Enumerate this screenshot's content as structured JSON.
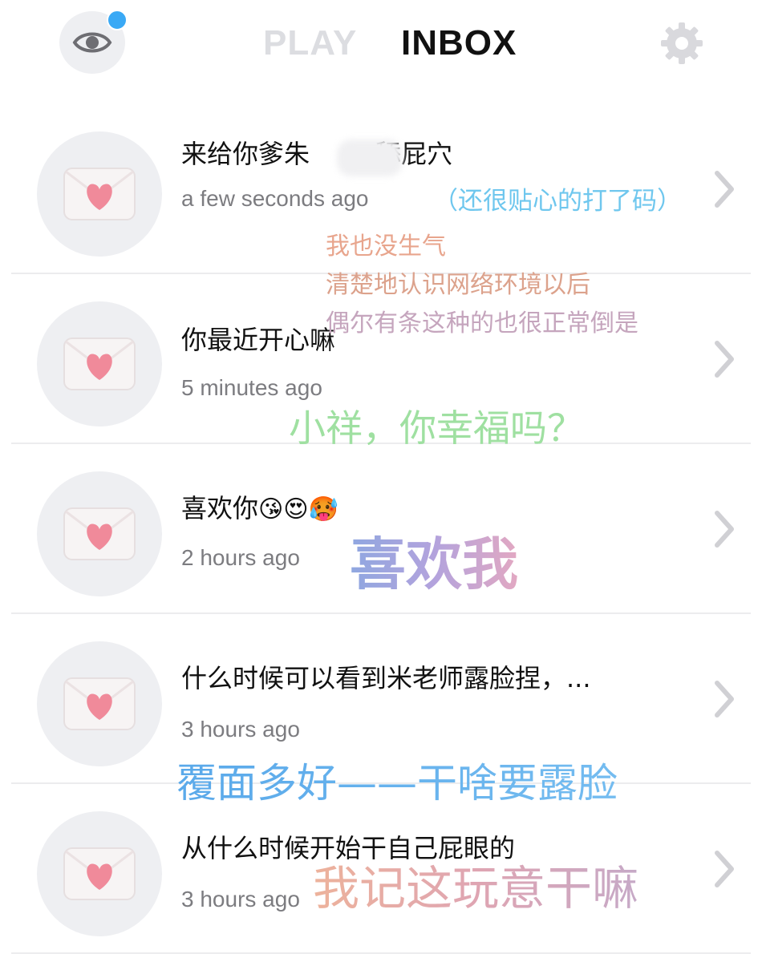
{
  "header": {
    "tabs": [
      {
        "label": "PLAY",
        "active": false
      },
      {
        "label": "INBOX",
        "active": true
      }
    ],
    "eye_icon": "eye-icon",
    "notification_dot_color": "#3aa9f5",
    "settings_icon": "gear-icon"
  },
  "messages": [
    {
      "text_before": "来给你爹朱",
      "text_after": "舔屁穴",
      "time": "a few seconds ago"
    },
    {
      "text": "你最近开心嘛",
      "time": "5 minutes ago"
    },
    {
      "text": "喜欢你",
      "emojis": "😘😍🥵",
      "time": "2 hours ago"
    },
    {
      "text": "什么时候可以看到米老师露脸捏，...",
      "time": "3 hours ago"
    },
    {
      "text": "从什么时候开始干自己屁眼的",
      "time": "3 hours ago"
    }
  ],
  "annotations": {
    "n1": "（还很贴心的打了码）",
    "n2": "我也没生气",
    "n3": "清楚地认识网络环境以后",
    "n4": "偶尔有条这种的也很正常倒是",
    "n5": "小祥，你幸福吗？",
    "n6": "喜欢我",
    "n7": "覆面多好——干啥要露脸",
    "n8": "我记这玩意干嘛"
  },
  "colors": {
    "inbox_tab": "#111111",
    "play_tab": "#dcdde1",
    "heart": "#f08a9a",
    "envelope": "#f7f4f4"
  }
}
